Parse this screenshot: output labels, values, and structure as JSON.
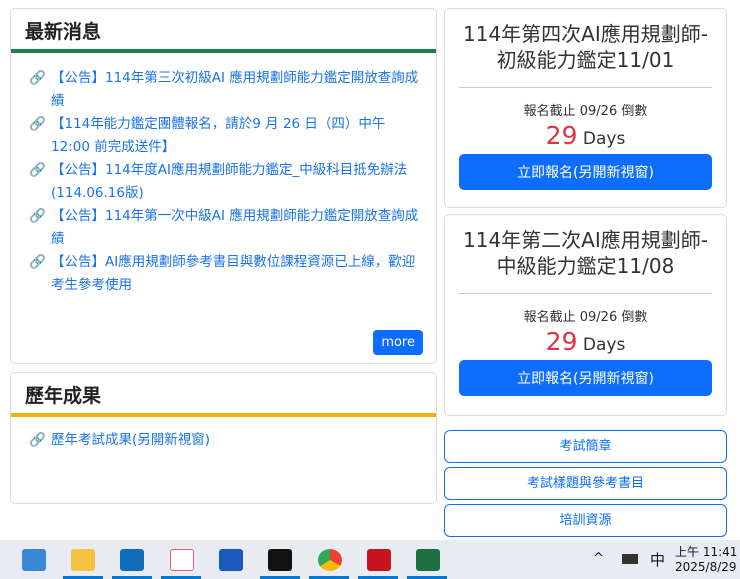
{
  "news": {
    "title": "最新消息",
    "items": [
      "【公告】114年第三次初級AI 應用規劃師能力鑑定開放查詢成績",
      "【114年能力鑑定團體報名，請於9 月 26 日（四）中午 12:00 前完成送件】",
      "【公告】114年度AI應用規劃師能力鑑定_中級科目抵免辦法(114.06.16版)",
      "【公告】114年第一次中級AI 應用規劃師能力鑑定開放查詢成績",
      "【公告】AI應用規劃師參考書目與數位課程資源已上線，歡迎考生參考使用"
    ],
    "more": "more",
    "accent": "#1e7e4a"
  },
  "results": {
    "title": "歷年成果",
    "link": "歷年考試成果(另開新視窗)",
    "accent": "#f0b400"
  },
  "exams": [
    {
      "title": "114年第四次AI應用規劃師-初級能力鑑定11/01",
      "deadline": "報名截止 09/26 倒數",
      "days": "29",
      "unit": "Days",
      "button": "立即報名(另開新視窗)"
    },
    {
      "title": "114年第二次AI應用規劃師-中級能力鑑定11/08",
      "deadline": "報名截止 09/26 倒數",
      "days": "29",
      "unit": "Days",
      "button": "立即報名(另開新視窗)"
    }
  ],
  "links": [
    "考試簡章",
    "考試樣題與參考書目",
    "培訓資源"
  ],
  "taskbar": {
    "ime": "中",
    "time": "上午 11:41",
    "date": "2025/8/29",
    "chevron": "^"
  }
}
